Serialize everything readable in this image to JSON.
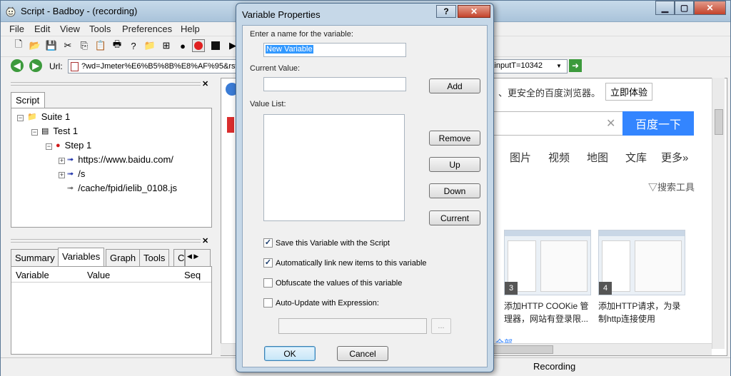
{
  "window": {
    "title": "Script - Badboy - (recording)",
    "controls": {
      "minimize": "▁",
      "maximize": "▢",
      "close": "✕"
    }
  },
  "menu": [
    "File",
    "Edit",
    "View",
    "Tools",
    "Preferences",
    "Help"
  ],
  "address_bar": {
    "label": "Url:",
    "value": "?wd=Jmeter%E6%B5%8B%E8%AF%95&rsv_sp",
    "value_tail": "1&inputT=10342"
  },
  "script_panel": {
    "close": "✕",
    "tab": "Script",
    "tree": [
      {
        "label": "Suite 1",
        "icon": "folder-icon"
      },
      {
        "label": "Test 1",
        "icon": "test-icon"
      },
      {
        "label": "Step 1",
        "icon": "step-icon"
      },
      {
        "label": "https://www.baidu.com/",
        "icon": "request-icon"
      },
      {
        "label": "/s",
        "icon": "request-icon"
      },
      {
        "label": "/cache/fpid/ielib_0108.js",
        "icon": "request-icon"
      }
    ]
  },
  "lower_panel": {
    "close": "✕",
    "tabs": [
      "Summary",
      "Variables",
      "Graph",
      "Tools",
      "C"
    ],
    "active_tab": "Variables",
    "columns": [
      "Variable",
      "Value",
      "Seq"
    ]
  },
  "browser": {
    "banner": "、更安全的百度浏览器。",
    "banner_button": "立即体验",
    "search_button": "百度一下",
    "search_clear": "✕",
    "nav": [
      "图片",
      "视频",
      "地图",
      "文库",
      "更多»"
    ],
    "search_tools": "搜索工具",
    "results": [
      {
        "num": "3",
        "caption": "添加HTTP COOKie 管理器，网站有登录限..."
      },
      {
        "num": "4",
        "caption": "添加HTTP请求，为录制http连接使用"
      }
    ],
    "footer_fragment": "全部"
  },
  "status": {
    "recording": "Recording"
  },
  "dialog": {
    "title": "Variable Properties",
    "help": "?",
    "close": "✕",
    "name_label": "Enter a name for the variable:",
    "name_value": "New Variable",
    "current_value_label": "Current Value:",
    "current_value": "",
    "add_button": "Add",
    "value_list_label": "Value List:",
    "remove_button": "Remove",
    "up_button": "Up",
    "down_button": "Down",
    "current_button": "Current",
    "checkboxes": [
      {
        "label": "Save this Variable with the Script",
        "checked": true
      },
      {
        "label": "Automatically link new items to this variable",
        "checked": true
      },
      {
        "label": "Obfuscate the values of this variable",
        "checked": false
      },
      {
        "label": "Auto-Update with Expression:",
        "checked": false
      }
    ],
    "expression_value": "",
    "expression_button": "...",
    "ok_button": "OK",
    "cancel_button": "Cancel"
  }
}
